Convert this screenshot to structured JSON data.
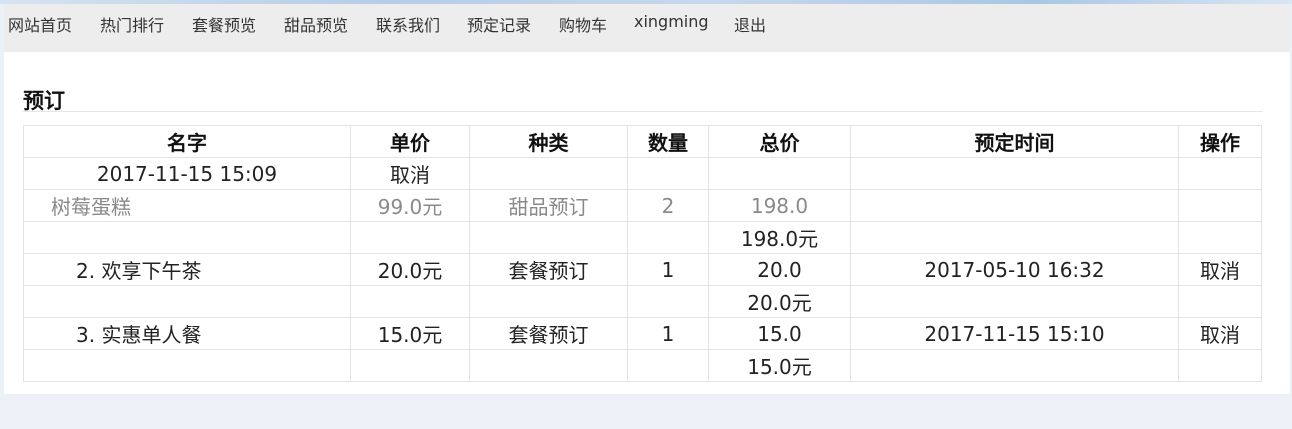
{
  "nav": {
    "items": [
      "网站首页",
      "热门排行",
      "套餐预览",
      "甜品预览",
      "联系我们",
      "预定记录",
      "购物车",
      "xingming",
      "退出"
    ]
  },
  "section": {
    "title": "预订"
  },
  "table": {
    "headers": [
      "名字",
      "单价",
      "种类",
      "数量",
      "总价",
      "预定时间",
      "操作"
    ],
    "overlay": {
      "time": "2017-11-15 15:09",
      "action": "取消"
    },
    "rows": [
      {
        "name": "树莓蛋糕",
        "price": "99.0元",
        "type": "甜品预订",
        "qty": "2",
        "total": "198.0",
        "total_yuan": "198.0元",
        "time": "",
        "action": ""
      },
      {
        "name": "2. 欢享下午茶",
        "price": "20.0元",
        "type": "套餐预订",
        "qty": "1",
        "total": "20.0",
        "total_yuan": "20.0元",
        "time": "2017-05-10 16:32",
        "action": "取消"
      },
      {
        "name": "3. 实惠单人餐",
        "price": "15.0元",
        "type": "套餐预订",
        "qty": "1",
        "total": "15.0",
        "total_yuan": "15.0元",
        "time": "2017-11-15 15:10",
        "action": "取消"
      }
    ]
  },
  "colors": {
    "page_bg": "#ecf1f8",
    "nav_bg": "#ededed",
    "muted_text": "#8a8a8a"
  }
}
